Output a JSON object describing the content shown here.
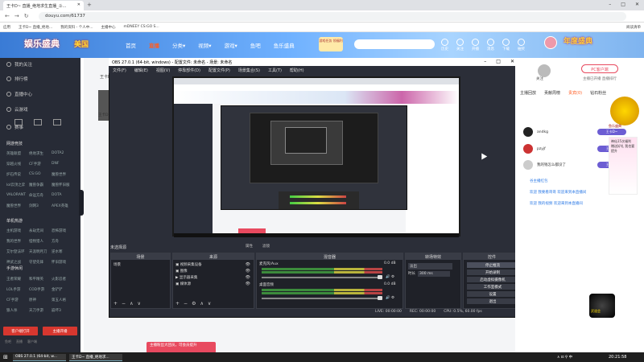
{
  "browser": {
    "tab_title": "王卡D~ 直播_绝地求生直播_斗...",
    "new_tab": "+",
    "url": "douyu.com/61737",
    "bookmarks": [
      "应用",
      "王卡D~ 直播_绝地...",
      "我的资料 - 个人中...",
      "主播中心",
      "mDNEEY CS:GO S..."
    ],
    "bookmarks_right": "阅读清单",
    "win_controls": [
      "–",
      "□",
      "✕"
    ]
  },
  "site": {
    "logo": "娱乐盛典",
    "logo2": "美国",
    "nav": [
      "首页",
      "直播",
      "分类▾",
      "视频▾",
      "游戏▾",
      "鱼吧",
      "鱼乐盛典"
    ],
    "download_btn": "游戏任务 领福利",
    "search_placeholder": "",
    "user_icons": [
      "历史",
      "关注",
      "开播",
      "消息",
      "下载",
      "抽奖"
    ],
    "right_banner": "年度盛典"
  },
  "sidebar": {
    "items": [
      "我的关注",
      "排行榜",
      "直播中心",
      "云游戏"
    ],
    "icons_row": [
      "赛事"
    ],
    "section1": "网游竞技",
    "grid1": [
      "英雄联盟",
      "绝地求生",
      "DOTA2",
      "穿越火线",
      "CF手游",
      "DNF",
      "炉石传说",
      "CS:GO",
      "魔兽世界",
      "lol云顶之弈",
      "魔兽争霸",
      "魔兽怀旧服",
      "VALORANT",
      "命运方舟",
      "DOTA",
      "魔兽世界",
      "剑网3",
      "APEX英雄"
    ],
    "section2": "单机热游",
    "grid2": [
      "主机游戏",
      "永劫无间",
      "恐怖游戏",
      "我的世界",
      "怪物猎人",
      "方舟",
      "艾尔登法环",
      "天涯明月刀",
      "逆水寒",
      "神武之战",
      "守望先锋",
      "怀旧游戏"
    ],
    "section3": "手游休闲",
    "grid3": [
      "王者荣耀",
      "和平精英",
      "火影忍者",
      "LOL手游",
      "COD手游",
      "金铲铲",
      "CF手游",
      "原神",
      "第五人格",
      "狼人杀",
      "天刀手游",
      "崩坏3"
    ],
    "btn_pay": "客户端打开",
    "btn_open": "主播开播",
    "footer": [
      "鱼吧",
      "直播",
      "客户端"
    ]
  },
  "main": {
    "title": "王卡D~",
    "toast": "主播粉丝大团员，可会员提升",
    "thumb_label": "王卡D~"
  },
  "obs": {
    "title": "OBS 27.0.1 (64-bit, windows) - 配置文件: 未命名 - 场景: 未命名",
    "menu": [
      "文件(F)",
      "编辑(E)",
      "视图(V)",
      "停靠部件(D)",
      "配置文件(P)",
      "场景集合(S)",
      "工具(T)",
      "帮助(H)"
    ],
    "status_label": "未选择源",
    "props": [
      "属性",
      "滤镜"
    ],
    "docks": {
      "scenes": {
        "title": "场景",
        "items": [
          "场景"
        ]
      },
      "sources": {
        "title": "来源",
        "items": [
          "视频采集设备",
          "图像",
          "显示器采集",
          "媒体源"
        ]
      },
      "mixer": {
        "title": "混音器",
        "tracks": [
          {
            "name": "麦克风/Aux",
            "db": "0.0 dB"
          },
          {
            "name": "桌面音频",
            "db": "0.0 dB"
          }
        ]
      },
      "transitions": {
        "title": "转场特效",
        "type": "淡出",
        "duration_label": "时长",
        "duration": "300 ms"
      },
      "controls": {
        "title": "控件",
        "buttons": [
          "停止推流",
          "开始录制",
          "启动虚拟摄像机",
          "工作室模式",
          "设置",
          "退出"
        ]
      }
    },
    "status": [
      "LIVE: 00:00:00",
      "REC: 00:00:00",
      "CPU: 0.5%, 60.00 fps"
    ]
  },
  "right": {
    "pc_link": "PC客户端",
    "follow": "关注",
    "ranking": "主播已开播 直播排行",
    "tabs": [
      "主播回放",
      "贡献周榜",
      "贵宾(0)",
      "钻石粉丝"
    ],
    "users": [
      {
        "name": "andkg",
        "badge": "王卡D~"
      },
      {
        "name": "pzyjf",
        "badge": "王卡D~"
      },
      {
        "name": "我的钱怎么都没了",
        "badge": "王卡D~"
      }
    ],
    "chat": [
      {
        "user": "谷主播红包",
        "text": ""
      },
      {
        "user": "欢迎 我要看哥哥 欢迎来到本直播间",
        "text": ""
      },
      {
        "user": "欢迎 我的视频 欢迎来到本直播间",
        "text": ""
      }
    ],
    "gift_label": "鱼乐盛典",
    "promo": "神仙15次福利 赠送好礼 我也要提升",
    "wudao_label": "武道会"
  },
  "taskbar": {
    "start": "⊞",
    "items": [
      "OBS 27.0.1 (64-bit, w...",
      "王卡D~ 直播_绝地求..."
    ],
    "tray": "∧ ⊡ ⚲ 中",
    "clock": "20:21:58"
  },
  "colors": {
    "brand_orange": "#ff5d23",
    "sidebar_bg": "#272b36",
    "obs_bg": "#2b2e38",
    "accent_red": "#e84a5f"
  }
}
